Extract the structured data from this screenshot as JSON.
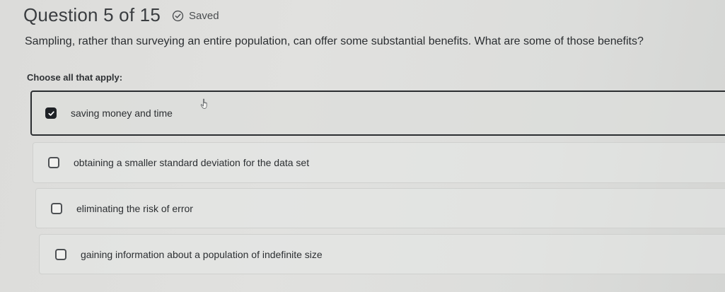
{
  "header": {
    "question_title": "Question 5 of 15",
    "saved_label": "Saved"
  },
  "question": {
    "prompt": "Sampling, rather than surveying an entire population, can offer some substantial benefits. What are some of those benefits?",
    "instruction": "Choose all that apply:"
  },
  "options": [
    {
      "label": "saving money and time",
      "checked": true
    },
    {
      "label": "obtaining a smaller standard deviation for the data set",
      "checked": false
    },
    {
      "label": "eliminating the risk of error",
      "checked": false
    },
    {
      "label": "gaining information about a population of indefinite size",
      "checked": false
    }
  ],
  "icons": {
    "saved": "check-circle-icon",
    "checkbox_checked": "checkmark-icon",
    "cursor": "hand-pointer-icon"
  }
}
